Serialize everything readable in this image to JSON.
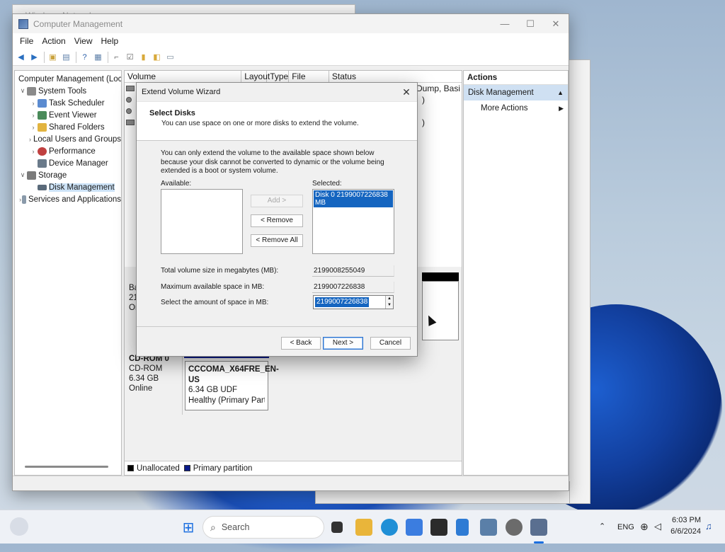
{
  "background_window": {
    "title": "Windows Network"
  },
  "mmc": {
    "title": "Computer Management",
    "window_buttons": {
      "minimize": "—",
      "maximize": "☐",
      "close": "✕"
    },
    "menu": [
      "File",
      "Action",
      "View",
      "Help"
    ],
    "tree": [
      {
        "label": "Computer Management (Local",
        "twisty": "",
        "icon_color": "#5a7fb0"
      },
      {
        "label": "System Tools",
        "twisty": "∨",
        "icon_color": "#8a8a8a"
      },
      {
        "label": "Task Scheduler",
        "twisty": "›",
        "icon_color": "#5b8bd0"
      },
      {
        "label": "Event Viewer",
        "twisty": "›",
        "icon_color": "#4a8a5a"
      },
      {
        "label": "Shared Folders",
        "twisty": "›",
        "icon_color": "#e2b440"
      },
      {
        "label": "Local Users and Groups",
        "twisty": "›",
        "icon_color": "#6a8ac0"
      },
      {
        "label": "Performance",
        "twisty": "›",
        "icon_color": "#c04040"
      },
      {
        "label": "Device Manager",
        "twisty": "",
        "icon_color": "#6a7a8a"
      },
      {
        "label": "Storage",
        "twisty": "∨",
        "icon_color": "#7a7a7a"
      },
      {
        "label": "Disk Management",
        "twisty": "",
        "icon_color": "#5a6a7a",
        "selected": true
      },
      {
        "label": "Services and Applications",
        "twisty": "›",
        "icon_color": "#8a9aaa"
      }
    ],
    "columns": [
      "Volume",
      "Layout",
      "Type",
      "File System",
      "Status"
    ],
    "status_fragments": {
      "row1": "sh Dump, Basi",
      "row2": ")",
      "row4": ")"
    },
    "disks": {
      "disk0": {
        "line1": "Ba",
        "line2": "214",
        "line3": "On"
      },
      "cdrom": {
        "name": "CD-ROM 0",
        "type": "CD-ROM",
        "size": "6.34 GB",
        "state": "Online"
      },
      "cd_partition": {
        "name": "CCCOMA_X64FRE_EN-US",
        "size": "6.34 GB UDF",
        "status": "Healthy (Primary Partition"
      }
    },
    "legend": {
      "unallocated": "Unallocated",
      "primary": "Primary partition"
    },
    "actions": {
      "header": "Actions",
      "section": "Disk Management",
      "item": "More Actions"
    }
  },
  "wizard": {
    "title": "Extend Volume Wizard",
    "heading": "Select Disks",
    "subheading": "You can use space on one or more disks to extend the volume.",
    "note": "You can only extend the volume to the available space shown below because your disk cannot be converted to dynamic or the volume being extended is a boot or system volume.",
    "available_label": "Available:",
    "selected_label": "Selected:",
    "selected_items": [
      "Disk 0   2199007226838 MB"
    ],
    "add": "Add >",
    "remove": "< Remove",
    "remove_all": "< Remove All",
    "total_label": "Total volume size in megabytes (MB):",
    "total_value": "2199008255049",
    "max_label": "Maximum available space in MB:",
    "max_value": "2199007226838",
    "select_label": "Select the amount of space in MB:",
    "select_value": "2199007226838",
    "back": "< Back",
    "next": "Next >",
    "cancel": "Cancel"
  },
  "taskbar": {
    "search_placeholder": "Search",
    "language": "ENG",
    "time": "6:03 PM",
    "date": "6/6/2024"
  }
}
